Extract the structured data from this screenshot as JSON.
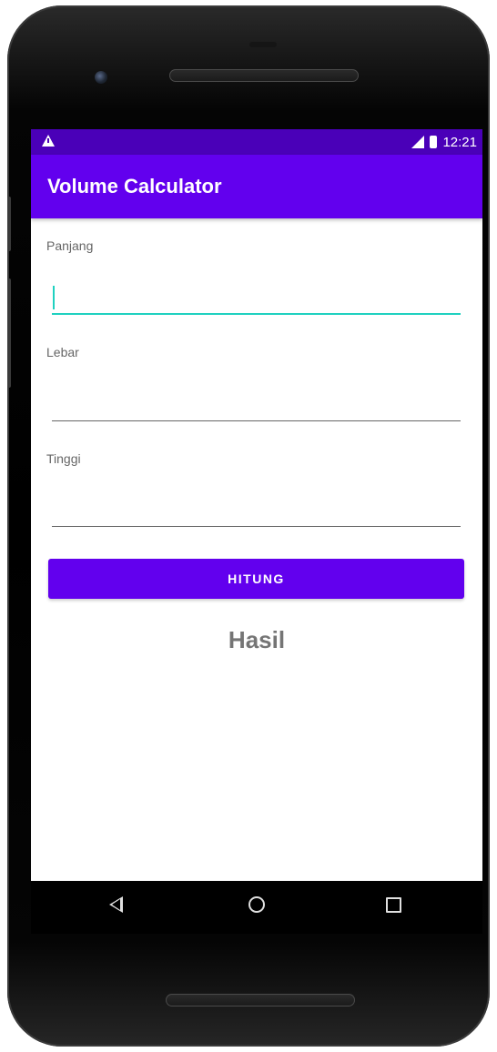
{
  "status_bar": {
    "time": "12:21",
    "left_icon": "warning-icon",
    "right_icons": [
      "signal-icon",
      "battery-icon"
    ],
    "color": "#4a00b8"
  },
  "app_bar": {
    "title": "Volume Calculator",
    "color": "#6200ee"
  },
  "form": {
    "fields": [
      {
        "label": "Panjang",
        "value": "",
        "focused": true
      },
      {
        "label": "Lebar",
        "value": "",
        "focused": false
      },
      {
        "label": "Tinggi",
        "value": "",
        "focused": false
      }
    ],
    "accent_color": "#1fd1c0"
  },
  "button": {
    "label": "HITUNG",
    "color": "#6200ee"
  },
  "result": {
    "text": "Hasil"
  },
  "nav_bar": {
    "icons": [
      "back-icon",
      "home-icon",
      "recents-icon"
    ]
  }
}
